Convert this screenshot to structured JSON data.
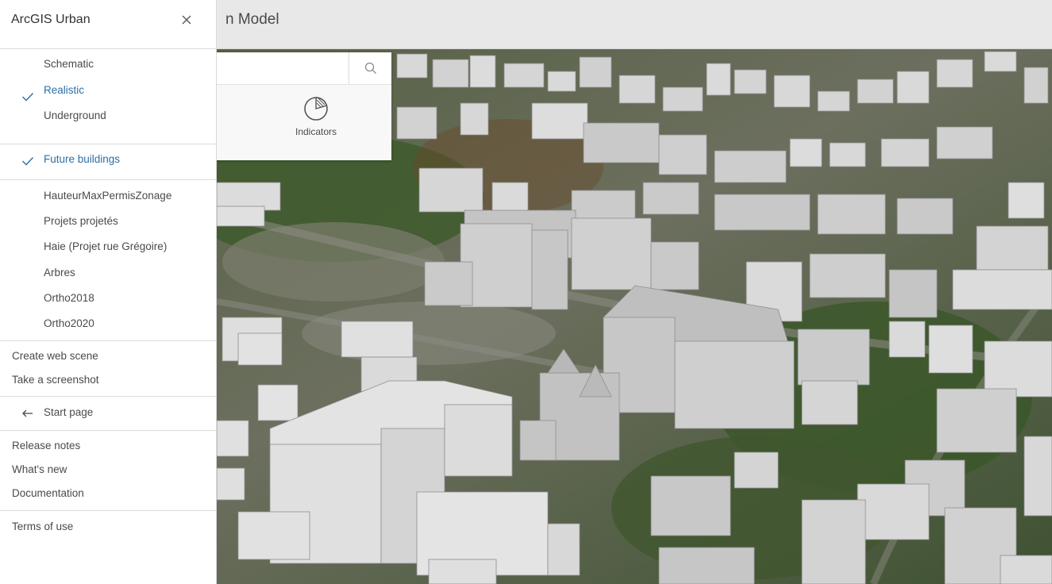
{
  "app": {
    "title": "ArcGIS Urban",
    "page_title_partial": "n Model"
  },
  "search": {
    "placeholder": "",
    "icon": "search-icon"
  },
  "tools": {
    "indicators_label": "Indicators",
    "indicators_icon": "pie-chart-icon"
  },
  "menu": {
    "views": [
      {
        "label": "Schematic",
        "checked": false
      },
      {
        "label": "Realistic",
        "checked": true
      },
      {
        "label": "Underground",
        "checked": false
      }
    ],
    "future": {
      "label": "Future buildings",
      "checked": true
    },
    "layers": [
      {
        "label": "HauteurMaxPermisZonage"
      },
      {
        "label": "Projets projetés"
      },
      {
        "label": "Haie (Projet rue Grégoire)"
      },
      {
        "label": "Arbres"
      },
      {
        "label": "Ortho2018"
      },
      {
        "label": "Ortho2020"
      }
    ],
    "actions": [
      {
        "label": "Create web scene"
      },
      {
        "label": "Take a screenshot"
      }
    ],
    "start_page": {
      "label": "Start page",
      "icon": "arrow-left-icon"
    },
    "info": [
      {
        "label": "Release notes"
      },
      {
        "label": "What's new"
      },
      {
        "label": "Documentation"
      }
    ],
    "terms": {
      "label": "Terms of use"
    }
  },
  "colors": {
    "accent": "#2b6fa8",
    "text": "#4a4a4a",
    "building": "#d2d2d2",
    "header": "#e8e8e8"
  }
}
